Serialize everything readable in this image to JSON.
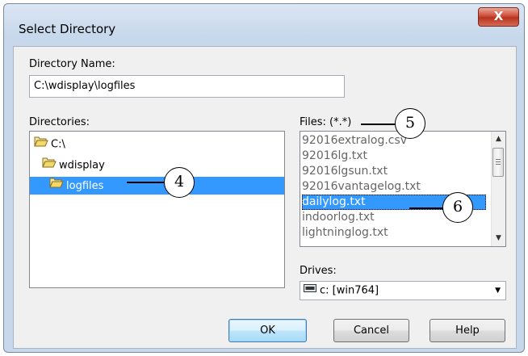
{
  "window": {
    "title": "Select Directory",
    "close_glyph": "X"
  },
  "directory_name": {
    "label": "Directory Name:",
    "value": "C:\\wdisplay\\logfiles"
  },
  "directories": {
    "label": "Directories:",
    "items": [
      {
        "label": "C:\\",
        "icon": "open-folder-icon"
      },
      {
        "label": "wdisplay",
        "icon": "open-folder-icon"
      },
      {
        "label": "logfiles",
        "icon": "open-folder-icon",
        "selected": true
      }
    ]
  },
  "files": {
    "label": "Files: (*.*)",
    "items": [
      "92016extralog.csv",
      "92016lg.txt",
      "92016lgsun.txt",
      "92016vantagelog.txt",
      "dailylog.txt",
      "indoorlog.txt",
      "lightninglog.txt"
    ],
    "selected_index": 4
  },
  "drives": {
    "label": "Drives:",
    "value": "c: [win764]",
    "icon": "drive-icon"
  },
  "buttons": {
    "ok": "OK",
    "cancel": "Cancel",
    "help": "Help"
  },
  "callouts": {
    "dir_selection": "4",
    "files_label": "5",
    "file_selection": "6"
  },
  "colors": {
    "selection": "#3399ff",
    "title_bar": "#c7d8ec",
    "close_button": "#c9412b"
  }
}
